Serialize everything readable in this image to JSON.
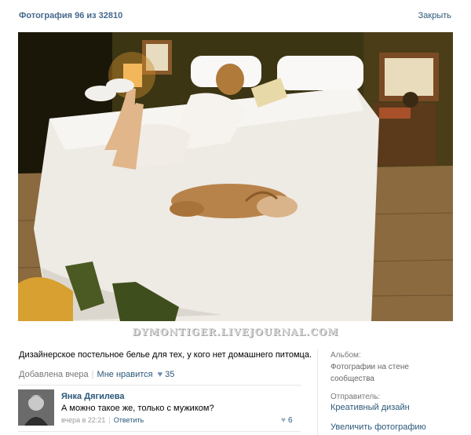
{
  "header": {
    "title": "Фотография 96 из 32810",
    "close_label": "Закрыть"
  },
  "photo": {
    "watermark": "DYMONTIGER.LIVEJOURNAL.COM"
  },
  "post": {
    "caption": "Дизайнерское постельное белье для тех, у кого нет домашнего питомца.",
    "added": "Добавлена вчера",
    "like_label": "Мне нравится",
    "like_count": "35"
  },
  "comment": {
    "author": "Янка Дягилева",
    "text": "А можно такое же, только с мужиком?",
    "date": "вчера в 22:21",
    "reply_label": "Ответить",
    "like_count": "6"
  },
  "sidebar": {
    "album_label": "Альбом:",
    "album_value": "Фотографии на стене сообщества",
    "sender_label": "Отправитель:",
    "sender_value": "Креативный дизайн",
    "enlarge_label": "Увеличить фотографию"
  },
  "colors": {
    "link": "#2b587a",
    "title": "#45688e",
    "muted": "#777777"
  }
}
